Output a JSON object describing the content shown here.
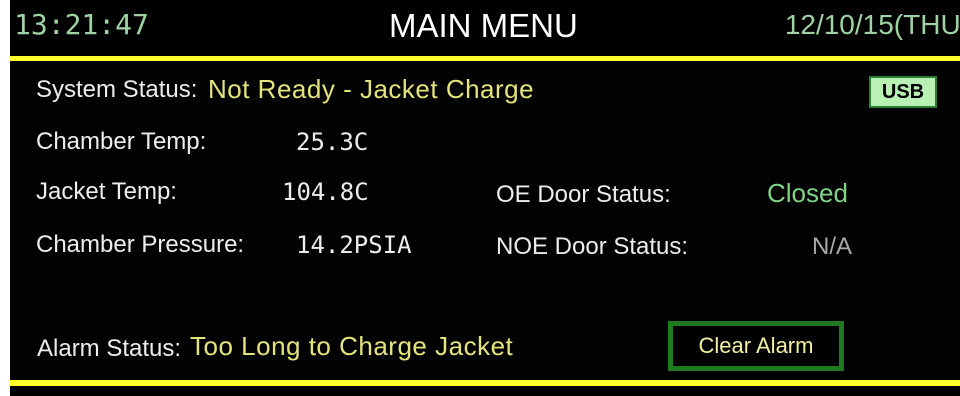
{
  "header": {
    "time": "13:21:47",
    "title": "MAIN MENU",
    "date": "12/10/15(THU)"
  },
  "system_status": {
    "label": "System Status:",
    "value": "Not Ready - Jacket Charge"
  },
  "usb_button": {
    "label": "USB"
  },
  "readings": {
    "chamber_temp": {
      "label": "Chamber Temp:",
      "value": "25.3C"
    },
    "jacket_temp": {
      "label": "Jacket Temp:",
      "value": "104.8C"
    },
    "chamber_pressure": {
      "label": "Chamber Pressure:",
      "value": "14.2PSIA"
    }
  },
  "doors": {
    "oe": {
      "label": "OE Door Status:",
      "value": "Closed"
    },
    "noe": {
      "label": "NOE Door Status:",
      "value": "N/A"
    }
  },
  "alarm": {
    "label": "Alarm Status:",
    "value": "Too Long to Charge Jacket",
    "clear_label": "Clear Alarm"
  },
  "colors": {
    "background": "#020202",
    "accent_yellow_line": "#ffff2e",
    "status_yellow": "#e4e47c",
    "status_green": "#7ed387",
    "button_green": "#b9f0b4",
    "button_border": "#1f7a1f"
  }
}
